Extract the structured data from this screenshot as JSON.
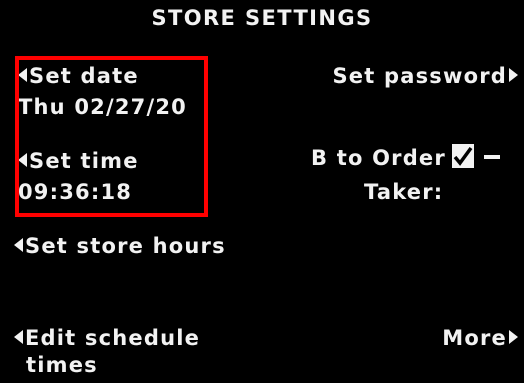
{
  "screen": {
    "title": "STORE SETTINGS"
  },
  "menu": {
    "set_date_label": "Set date",
    "date_value": "Thu 02/27/20",
    "set_time_label": "Set time",
    "time_value": "09:36:18",
    "set_password_label": "Set password",
    "b_to_order_label": "B to Order",
    "taker_label": "Taker:",
    "set_store_hours_label": "Set store hours",
    "edit_schedule_label": "Edit schedule",
    "edit_schedule_label_2": "times",
    "more_label": "More"
  },
  "toggle": {
    "b_to_order_checked": true
  },
  "colors": {
    "background": "#000000",
    "text": "#f2f2f2",
    "highlight": "#ff0000"
  },
  "icons": {
    "left": "left-arrow-icon",
    "right": "right-arrow-icon",
    "check": "checkmark-icon"
  }
}
